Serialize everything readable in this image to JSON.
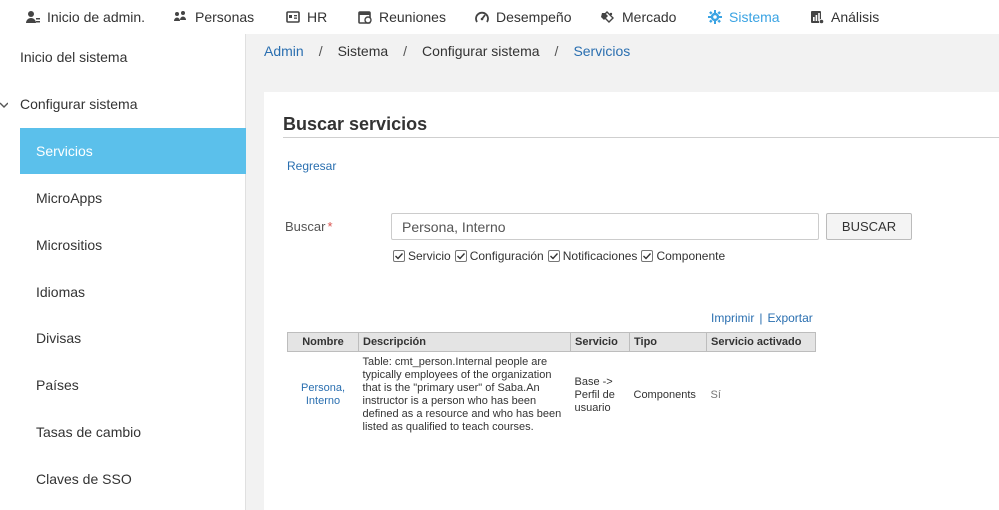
{
  "nav": [
    {
      "label": "Inicio de admin.",
      "icon": "admin-home-icon"
    },
    {
      "label": "Personas",
      "icon": "people-icon"
    },
    {
      "label": "HR",
      "icon": "hr-icon"
    },
    {
      "label": "Reuniones",
      "icon": "meetings-icon"
    },
    {
      "label": "Desempeño",
      "icon": "performance-icon"
    },
    {
      "label": "Mercado",
      "icon": "market-icon"
    },
    {
      "label": "Sistema",
      "icon": "gear-icon"
    },
    {
      "label": "Análisis",
      "icon": "analytics-icon"
    }
  ],
  "sidebar": {
    "items": [
      {
        "label": "Inicio del sistema"
      },
      {
        "label": "Configurar sistema"
      },
      {
        "label": "Servicios"
      },
      {
        "label": "MicroApps"
      },
      {
        "label": "Micrositios"
      },
      {
        "label": "Idiomas"
      },
      {
        "label": "Divisas"
      },
      {
        "label": "Países"
      },
      {
        "label": "Tasas de cambio"
      },
      {
        "label": "Claves de SSO"
      }
    ]
  },
  "breadcrumb": [
    "Admin",
    "Sistema",
    "Configurar sistema",
    "Servicios"
  ],
  "page": {
    "title": "Buscar servicios",
    "back_label": "Regresar"
  },
  "search": {
    "label": "Buscar",
    "required_mark": "*",
    "value": "Persona, Interno",
    "button_label": "BUSCAR",
    "filters": [
      {
        "label": "Servicio",
        "checked": true
      },
      {
        "label": "Configuración",
        "checked": true
      },
      {
        "label": "Notificaciones",
        "checked": true
      },
      {
        "label": "Componente",
        "checked": true
      }
    ]
  },
  "actions": {
    "print_label": "Imprimir",
    "separator": "|",
    "export_label": "Exportar"
  },
  "table": {
    "headers": [
      "Nombre",
      "Descripción",
      "Servicio",
      "Tipo",
      "Servicio activado"
    ],
    "rows": [
      {
        "name": "Persona, Interno",
        "description": "Table: cmt_person.Internal people are typically employees of the organization that is the \"primary user\" of Saba.An instructor is a person who has been defined as a resource and who has been listed as qualified to teach courses.",
        "service": "Base -> Perfil de usuario",
        "type": "Components",
        "active": "Sí"
      }
    ]
  },
  "colors": {
    "accent": "#3aa3e3",
    "active_sidebar": "#5bc0eb",
    "link": "#2a6fb0"
  }
}
